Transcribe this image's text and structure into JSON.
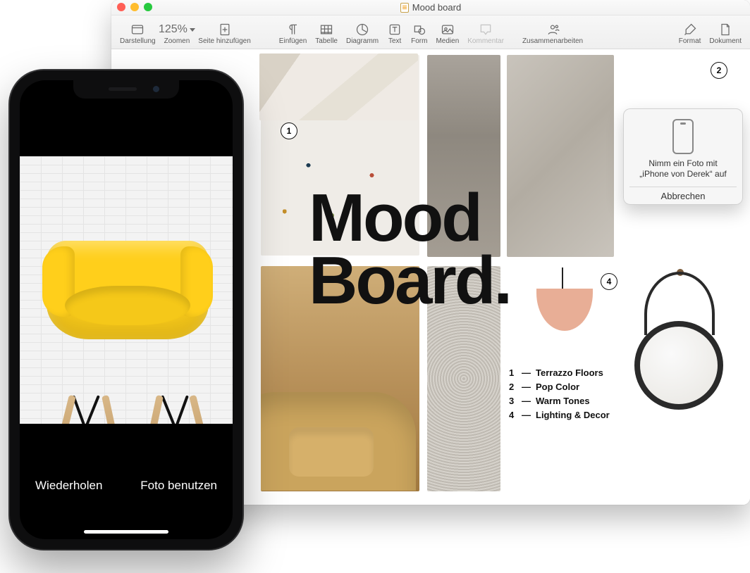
{
  "window": {
    "title": "Mood board"
  },
  "toolbar": {
    "view": "Darstellung",
    "zoom_label": "Zoomen",
    "zoom_value": "125%",
    "add_page": "Seite hinzufügen",
    "insert": "Einfügen",
    "table": "Tabelle",
    "chart": "Diagramm",
    "text": "Text",
    "shape": "Form",
    "media": "Medien",
    "comment": "Kommentar",
    "collab": "Zusammenarbeiten",
    "format": "Format",
    "document": "Dokument"
  },
  "doc": {
    "title_line1": "Mood",
    "title_line2": "Board.",
    "badges": {
      "b1": "1",
      "b2": "2",
      "b4": "4"
    },
    "legend": [
      {
        "n": "1",
        "label": "Terrazzo Floors"
      },
      {
        "n": "2",
        "label": "Pop Color"
      },
      {
        "n": "3",
        "label": "Warm Tones"
      },
      {
        "n": "4",
        "label": "Lighting & Decor"
      }
    ]
  },
  "popover": {
    "msg_line1": "Nimm ein Foto mit",
    "msg_line2": "„iPhone von Derek“ auf",
    "cancel": "Abbrechen"
  },
  "iphone": {
    "retake": "Wiederholen",
    "use": "Foto benutzen"
  }
}
